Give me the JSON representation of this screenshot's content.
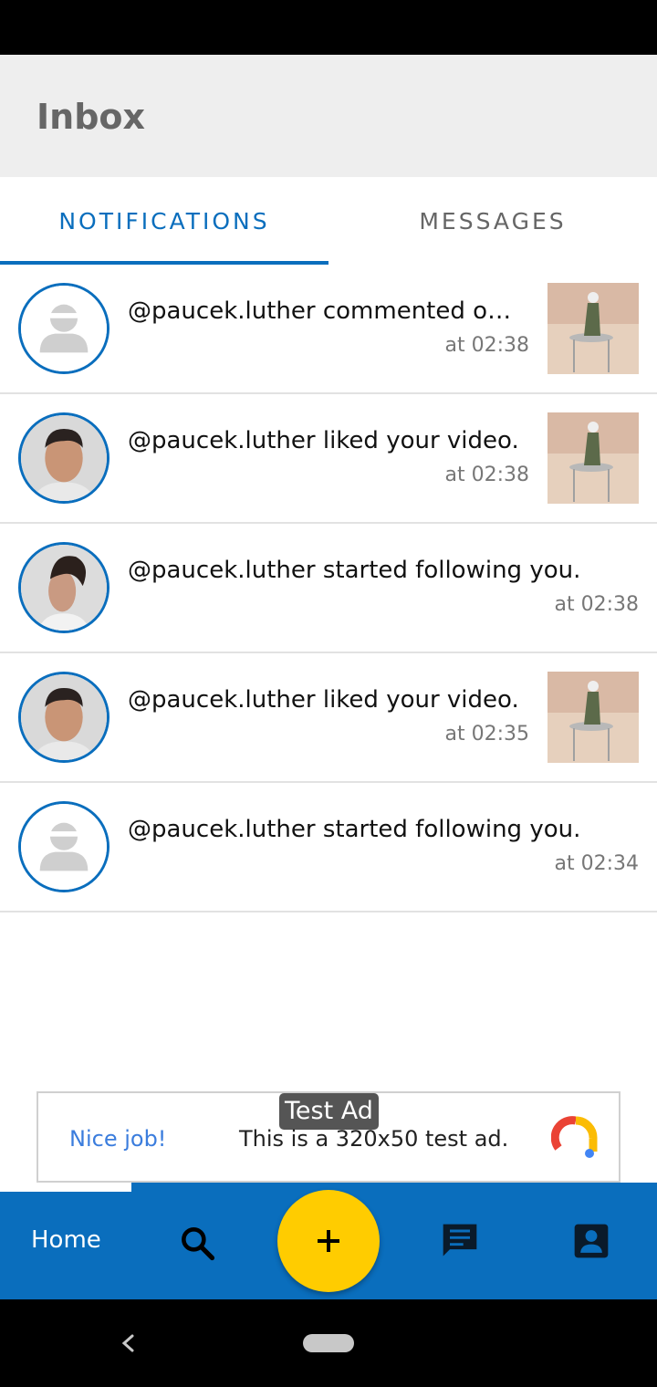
{
  "app": {
    "title": "Inbox"
  },
  "tabs": [
    {
      "label": "NOTIFICATIONS",
      "active": true
    },
    {
      "label": "MESSAGES",
      "active": false
    }
  ],
  "notifications": [
    {
      "text": "@paucek.luther commented on y...",
      "time": "at 02:38",
      "avatar": "default-avatar-icon",
      "has_thumbnail": true
    },
    {
      "text": "@paucek.luther liked your video.",
      "time": "at 02:38",
      "avatar": "man-photo",
      "has_thumbnail": true
    },
    {
      "text": "@paucek.luther started following you.",
      "time": "at 02:38",
      "avatar": "curly-man-photo",
      "has_thumbnail": false
    },
    {
      "text": "@paucek.luther liked your video.",
      "time": "at 02:35",
      "avatar": "man-photo",
      "has_thumbnail": true
    },
    {
      "text": "@paucek.luther started following you.",
      "time": "at 02:34",
      "avatar": "default-avatar-icon",
      "has_thumbnail": false
    }
  ],
  "ad": {
    "tag": "Test Ad",
    "nice": "Nice job!",
    "text": "This is a 320x50 test ad."
  },
  "bottom_nav": {
    "home_label": "Home",
    "icons": [
      "search-icon",
      "add-icon",
      "message-icon",
      "profile-icon"
    ]
  },
  "colors": {
    "accent": "#0a6ebd",
    "fab": "#ffcc00",
    "app_bar": "#eeeeee"
  }
}
